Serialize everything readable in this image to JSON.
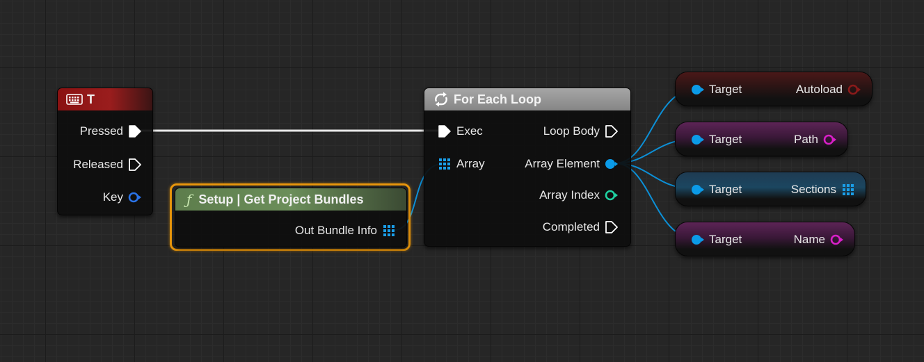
{
  "colors": {
    "exec": "#ffffff",
    "struct": "#0b9be8",
    "array": "#1a9ee8",
    "integer": "#1fd3a2",
    "string": "#d91fc8",
    "boolean": "#8a1a1a",
    "key": "#2a73e8",
    "highlight": "#e8960c"
  },
  "key_event": {
    "title": "T",
    "icon": "keyboard-icon",
    "pins": {
      "pressed": "Pressed",
      "released": "Released",
      "key": "Key"
    }
  },
  "setup_node": {
    "title": "Setup | Get Project Bundles",
    "icon": "function-icon",
    "icon_glyph": "ƒ",
    "pins": {
      "out_bundle_info": "Out Bundle Info"
    }
  },
  "loop_node": {
    "title": "For Each Loop",
    "icon": "loop-icon",
    "pins": {
      "exec": "Exec",
      "array": "Array",
      "loop_body": "Loop Body",
      "array_element": "Array Element",
      "array_index": "Array Index",
      "completed": "Completed"
    }
  },
  "getters": [
    {
      "input": "Target",
      "output": "Autoload"
    },
    {
      "input": "Target",
      "output": "Path"
    },
    {
      "input": "Target",
      "output": "Sections"
    },
    {
      "input": "Target",
      "output": "Name"
    }
  ]
}
